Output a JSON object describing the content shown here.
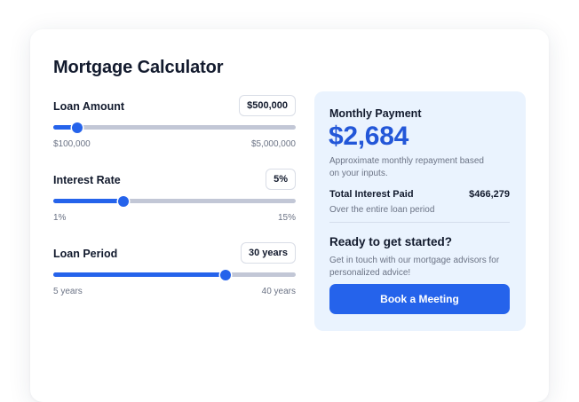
{
  "calculator": {
    "title": "Mortgage Calculator",
    "controls": [
      {
        "label": "Loan Amount",
        "value": "$500,000",
        "min_label": "$100,000",
        "max_label": "$5,000,000",
        "slider_fraction": 0.1
      },
      {
        "label": "Interest Rate",
        "value": "5%",
        "min_label": "1%",
        "max_label": "15%",
        "slider_fraction": 0.29
      },
      {
        "label": "Loan Period",
        "value": "30 years",
        "min_label": "5 years",
        "max_label": "40 years",
        "slider_fraction": 0.71
      }
    ]
  },
  "result": {
    "heading": "Monthly Payment",
    "amount": "$2,684",
    "description": "Approximate monthly repayment based on your inputs.",
    "interest_label": "Total Interest Paid",
    "interest_value": "$466,279",
    "interest_sub": "Over the entire loan period",
    "cta_heading": "Ready to get started?",
    "cta_text": "Get in touch with our mortgage advisors for personalized advice!",
    "button_label": "Book a Meeting"
  },
  "colors": {
    "accent": "#2563eb",
    "track": "#c2c7d6",
    "panel_bg": "#eaf3fe",
    "amount": "#2357d8"
  }
}
